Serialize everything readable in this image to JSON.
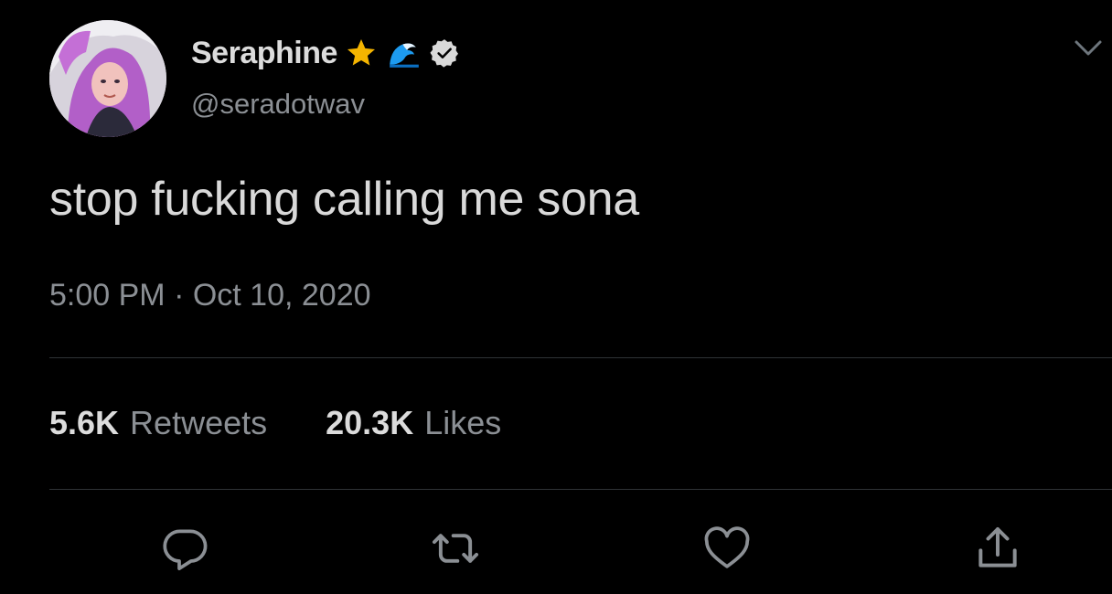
{
  "user": {
    "display_name": "Seraphine",
    "handle": "@seradotwav",
    "name_emojis": [
      "star-icon",
      "wave-icon"
    ],
    "verified": true
  },
  "tweet": {
    "text": "stop fucking calling me sona",
    "timestamp": "5:00 PM · Oct 10, 2020"
  },
  "stats": {
    "retweets_count": "5.6K",
    "retweets_label": "Retweets",
    "likes_count": "20.3K",
    "likes_label": "Likes"
  },
  "actions": [
    "reply-icon",
    "retweet-icon",
    "like-icon",
    "share-icon"
  ],
  "colors": {
    "background": "#000000",
    "primary_text": "#d9d9d9",
    "secondary_text": "#8b8f94",
    "divider": "#2f3336",
    "star": "#f4b400",
    "wave": "#1d9bf0"
  }
}
